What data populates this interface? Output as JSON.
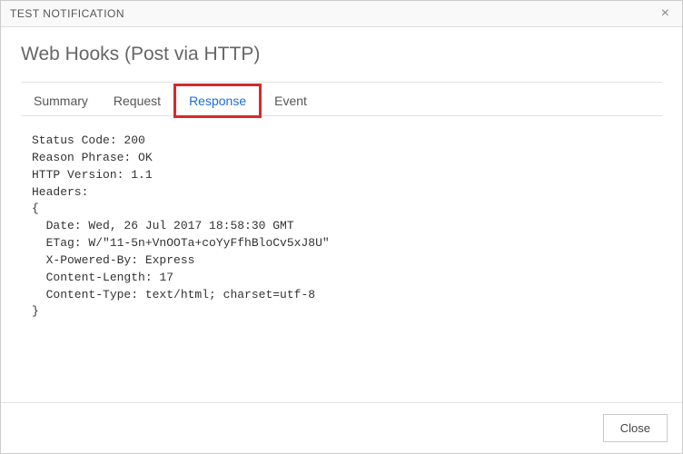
{
  "titlebar": {
    "title": "TEST NOTIFICATION",
    "close_glyph": "×"
  },
  "page_title": "Web Hooks (Post via HTTP)",
  "tabs": {
    "summary": "Summary",
    "request": "Request",
    "response": "Response",
    "event": "Event"
  },
  "response": {
    "status_code_label": "Status Code: ",
    "status_code": "200",
    "reason_label": "Reason Phrase: ",
    "reason": "OK",
    "http_version_label": "HTTP Version: ",
    "http_version": "1.1",
    "headers_label": "Headers:",
    "brace_open": "{",
    "headers": {
      "date_label": "  Date: ",
      "date": "Wed, 26 Jul 2017 18:58:30 GMT",
      "etag_label": "  ETag: ",
      "etag": "W/\"11-5n+VnOOTa+coYyFfhBloCv5xJ8U\"",
      "xpowered_label": "  X-Powered-By: ",
      "xpowered": "Express",
      "clen_label": "  Content-Length: ",
      "clen": "17",
      "ctype_label": "  Content-Type: ",
      "ctype": "text/html; charset=utf-8"
    },
    "brace_close": "}"
  },
  "footer": {
    "close_label": "Close"
  }
}
